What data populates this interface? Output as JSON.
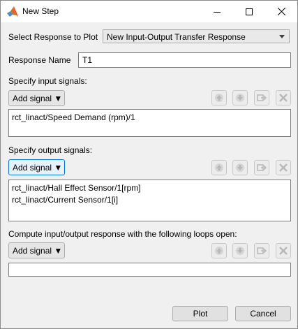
{
  "window": {
    "title": "New Step"
  },
  "response_select": {
    "label": "Select Response to Plot",
    "value": "New Input-Output Transfer Response"
  },
  "response_name": {
    "label": "Response Name",
    "value": "T1"
  },
  "input_section": {
    "label": "Specify input signals:",
    "add_label": "Add signal ▼",
    "items": [
      "rct_linact/Speed Demand (rpm)/1"
    ]
  },
  "output_section": {
    "label": "Specify output signals:",
    "add_label": "Add signal ▼",
    "items": [
      "rct_linact/Hall Effect Sensor/1[rpm]",
      "rct_linact/Current Sensor/1[i]"
    ]
  },
  "loops_section": {
    "label": "Compute input/output response with the following loops open:",
    "add_label": "Add signal ▼",
    "value": ""
  },
  "toolbar_icons": [
    "move-up-icon",
    "move-down-icon",
    "edit-signal-icon",
    "delete-icon"
  ],
  "buttons": {
    "plot": "Plot",
    "cancel": "Cancel"
  },
  "colors": {
    "titlebar": "#ffffff",
    "dialog_bg": "#f0f0f0",
    "focus_border": "#0078d7",
    "disabled_icon": "#b8b8b8"
  }
}
